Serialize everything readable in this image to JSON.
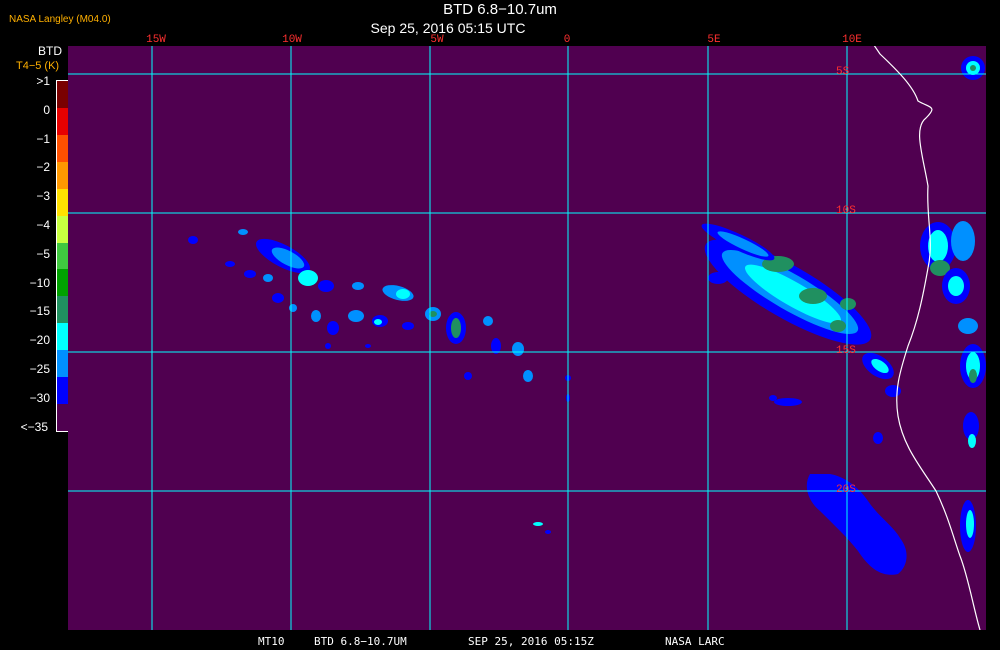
{
  "header": {
    "title": "BTD 6.8−10.7um",
    "subtitle": "Sep 25, 2016 05:15 UTC",
    "brand": "NASA Langley (M04.0)"
  },
  "legend": {
    "title1": "BTD",
    "title2": "T4−5 (K)",
    "labels": [
      ">1",
      "0",
      "−1",
      "−2",
      "−3",
      "−4",
      "−5",
      "−10",
      "−15",
      "−20",
      "−25",
      "−30",
      "<−35"
    ],
    "colors": [
      "#7a0000",
      "#e80000",
      "#ff5000",
      "#ff9800",
      "#ffe000",
      "#c8ff40",
      "#40c840",
      "#00a000",
      "#209060",
      "#00ffff",
      "#0090ff",
      "#0000ff",
      "#500050"
    ]
  },
  "map": {
    "background_color": "#500050",
    "grid_color": "#00ffff",
    "lon_labels": [
      "15W",
      "10W",
      "5W",
      "0",
      "5E",
      "10E"
    ],
    "lat_labels": [
      "5S",
      "10S",
      "15S",
      "20S"
    ],
    "coast_color": "#ffffff"
  },
  "footer": {
    "sat": "MT10",
    "product": "BTD 6.8−10.7UM",
    "datetime": "SEP 25, 2016 05:15Z",
    "org": "NASA LARC"
  }
}
